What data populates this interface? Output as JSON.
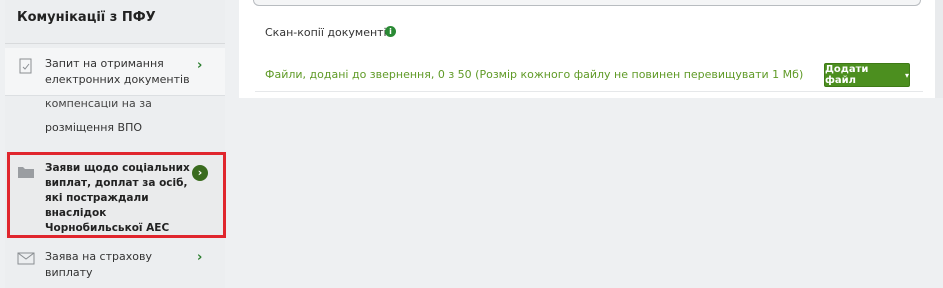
{
  "sidebar": {
    "title": "Комунікації з ПФУ",
    "items": [
      {
        "label": "Запит на отримання електронних документів",
        "icon": "document-check-icon",
        "bold": false
      },
      {
        "label_partial": "компенсацій на за",
        "label": "розміщення ВПО",
        "icon": "none",
        "bold": false
      },
      {
        "label": "Заяви щодо соціальних виплат, доплат за осіб, які постраждали внаслідок Чорнобильської АЕС",
        "icon": "folder-icon",
        "bold": true
      },
      {
        "label": "Заява на страхову виплату",
        "icon": "envelope-icon",
        "bold": false
      }
    ]
  },
  "main": {
    "scan_label": "Скан-копії документів",
    "info_icon": "info-icon",
    "files_text": "Файли, додані до звернення, 0 з 50 (Розмір кожного файлу не повинен перевищувати 1 Мб)",
    "add_file_button": "Додати файл"
  },
  "colors": {
    "accent_green": "#4c8f1f",
    "text_green": "#5f9a26",
    "highlight_red": "#e0262d"
  }
}
